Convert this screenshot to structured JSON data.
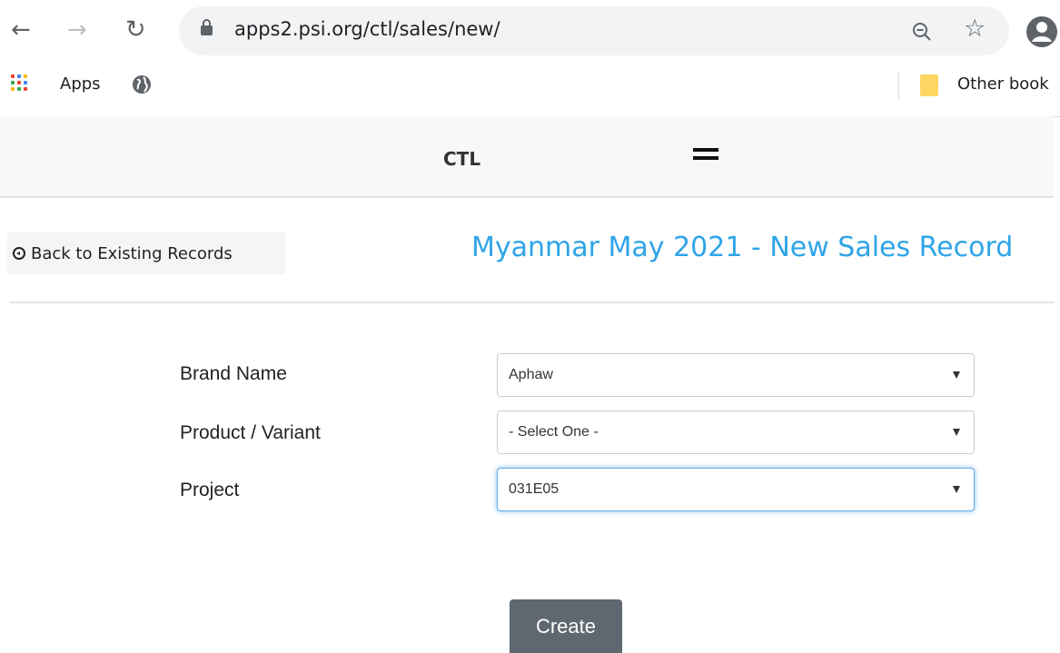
{
  "browser": {
    "url": "apps2.psi.org/ctl/sales/new/",
    "bookmarks": {
      "apps_label": "Apps",
      "other_label": "Other book"
    }
  },
  "site": {
    "brand": "CTL"
  },
  "page": {
    "back_label": "Back to Existing Records",
    "title": "Myanmar May 2021 - New Sales Record"
  },
  "form": {
    "fields": [
      {
        "label": "Brand Name",
        "value": "Aphaw"
      },
      {
        "label": "Product / Variant",
        "value": "- Select One -"
      },
      {
        "label": "Project",
        "value": "031E05"
      }
    ],
    "submit_label": "Create"
  },
  "colors": {
    "title": "#2fa4e7",
    "button": "#5f6870",
    "focus": "#66afe9"
  }
}
